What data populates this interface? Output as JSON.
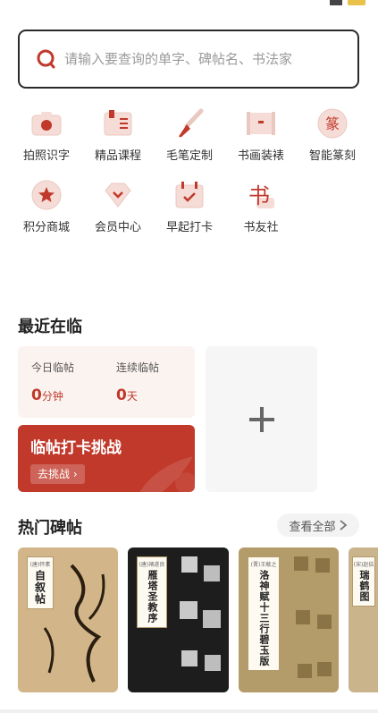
{
  "search": {
    "placeholder": "请输入要查询的单字、碑帖名、书法家"
  },
  "features": [
    {
      "label": "拍照识字",
      "icon": "camera-icon"
    },
    {
      "label": "精品课程",
      "icon": "book-icon"
    },
    {
      "label": "毛笔定制",
      "icon": "brush-icon"
    },
    {
      "label": "书画装裱",
      "icon": "scroll-icon"
    },
    {
      "label": "智能篆刻",
      "icon": "seal-icon"
    },
    {
      "label": "积分商城",
      "icon": "star-badge-icon"
    },
    {
      "label": "会员中心",
      "icon": "diamond-icon"
    },
    {
      "label": "早起打卡",
      "icon": "calendar-check-icon"
    },
    {
      "label": "书友社",
      "icon": "community-icon"
    }
  ],
  "seal_char": "篆",
  "community_char": "书",
  "recent": {
    "title": "最近在临",
    "today_label": "今日临帖",
    "today_value": "0",
    "today_unit": "分钟",
    "streak_label": "连续临帖",
    "streak_value": "0",
    "streak_unit": "天",
    "challenge_title": "临帖打卡挑战",
    "challenge_button": "去挑战 ›",
    "add_icon": "plus-icon"
  },
  "hot": {
    "title": "热门碑帖",
    "view_all": "查看全部",
    "books": [
      {
        "era": "(唐)怀素",
        "name": "自叙帖",
        "bg": "#d2b68a"
      },
      {
        "era": "(唐)褚遂良",
        "name": "雁塔圣教序",
        "bg": "#1d1d1d"
      },
      {
        "era": "(晋)王献之",
        "name": "洛神赋十三行碧玉版",
        "bg": "#b39c6a"
      },
      {
        "era": "(宋)赵佶",
        "name": "瑞鹤图",
        "bg": "#c9b48c"
      }
    ]
  },
  "colors": {
    "accent": "#c0392b",
    "pink_bg": "#fbf3f0"
  }
}
